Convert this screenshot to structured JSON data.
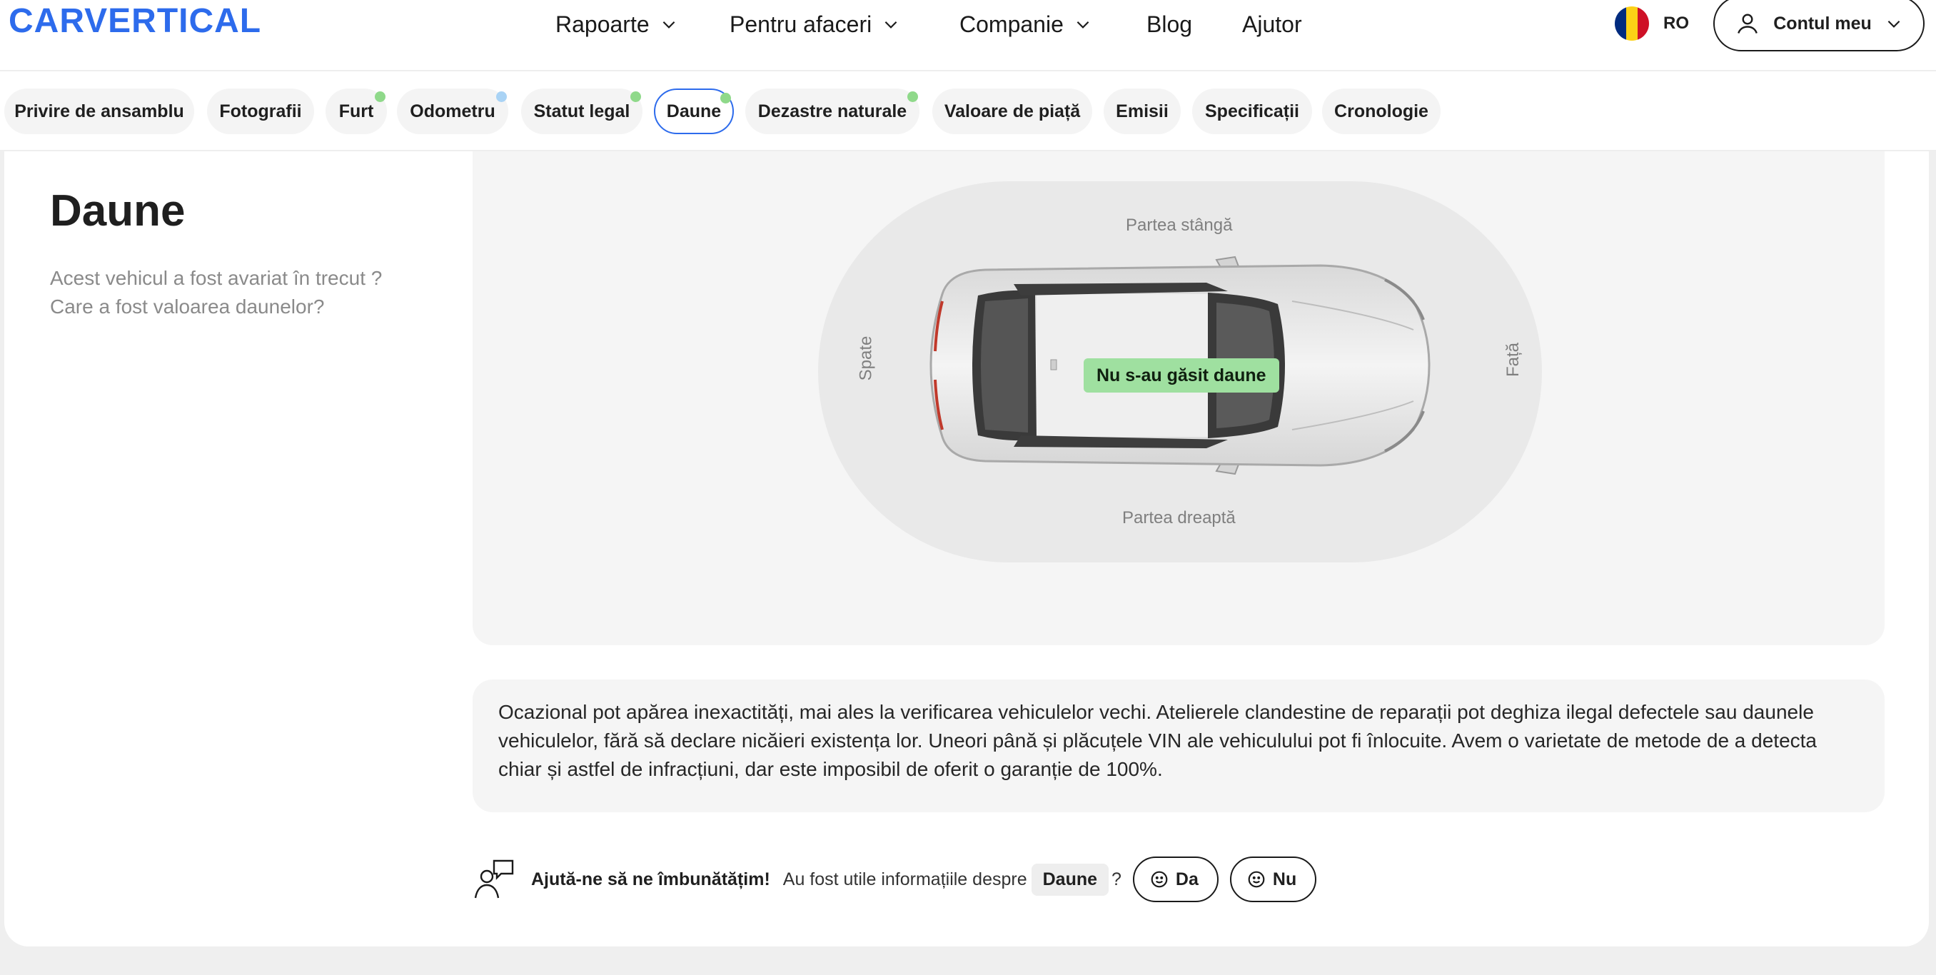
{
  "brand": {
    "logo_text": "CARVERTICAL",
    "accent": "#2d6bec"
  },
  "nav": {
    "items": [
      {
        "label": "Rapoarte",
        "has_dropdown": true
      },
      {
        "label": "Pentru afaceri",
        "has_dropdown": true
      },
      {
        "label": "Companie",
        "has_dropdown": true
      },
      {
        "label": "Blog",
        "has_dropdown": false
      },
      {
        "label": "Ajutor",
        "has_dropdown": false
      }
    ],
    "language": {
      "code": "RO",
      "flag_colors": [
        "#002b7f",
        "#fcd116",
        "#ce1126"
      ]
    },
    "account_label": "Contul meu"
  },
  "tabs": [
    {
      "label": "Privire de ansamblu",
      "dot": null,
      "active": false
    },
    {
      "label": "Fotografii",
      "dot": null,
      "active": false
    },
    {
      "label": "Furt",
      "dot": "#8fd98a",
      "active": false
    },
    {
      "label": "Odometru",
      "dot": "#a9d3f5",
      "active": false
    },
    {
      "label": "Statut legal",
      "dot": "#8fd98a",
      "active": false
    },
    {
      "label": "Daune",
      "dot": "#8fd98a",
      "active": true
    },
    {
      "label": "Dezastre naturale",
      "dot": "#8fd98a",
      "active": false
    },
    {
      "label": "Valoare de piață",
      "dot": null,
      "active": false
    },
    {
      "label": "Emisii",
      "dot": null,
      "active": false
    },
    {
      "label": "Specificații",
      "dot": null,
      "active": false
    },
    {
      "label": "Cronologie",
      "dot": null,
      "active": false
    }
  ],
  "section": {
    "title": "Daune",
    "subtitle_line1": "Acest vehicul a fost avariat în trecut ?",
    "subtitle_line2": "Care a fost valoarea daunelor?"
  },
  "diagram": {
    "label_left_side": "Partea stângă",
    "label_right_side": "Partea dreaptă",
    "label_rear": "Spate",
    "label_front": "Față",
    "status": "Nu s-au găsit daune",
    "status_color": "#9fe0a0"
  },
  "disclaimer": "Ocazional pot apărea inexactități, mai ales la verificarea vehiculelor vechi. Atelierele clandestine de reparații pot deghiza ilegal defectele sau daunele vehiculelor, fără să declare nicăieri existența lor. Uneori până și plăcuțele VIN ale vehiculului pot fi înlocuite. Avem o varietate de metode de a detecta chiar și astfel de infracțiuni, dar este imposibil de oferit o garanție de 100%.",
  "feedback": {
    "prompt_bold": "Ajută-ne să ne îmbunătățim!",
    "question": "Au fost utile informațiile despre",
    "topic": "Daune",
    "question_mark": "?",
    "yes_label": "Da",
    "no_label": "Nu"
  }
}
